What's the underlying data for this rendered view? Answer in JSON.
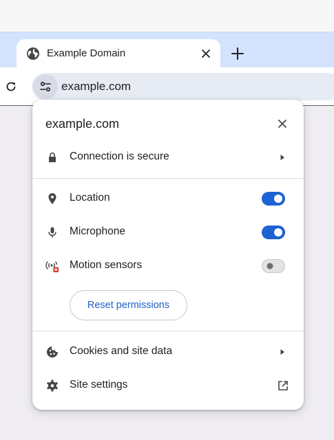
{
  "tab": {
    "title": "Example Domain",
    "icon": "globe-icon"
  },
  "omnibox": {
    "url": "example.com",
    "site_info_icon": "tune-icon"
  },
  "popup": {
    "title": "example.com",
    "connection_label": "Connection is secure",
    "permissions": [
      {
        "label": "Location",
        "icon": "location-pin-icon",
        "enabled": true
      },
      {
        "label": "Microphone",
        "icon": "microphone-icon",
        "enabled": true
      },
      {
        "label": "Motion sensors",
        "icon": "motion-sensors-blocked-icon",
        "enabled": false
      }
    ],
    "reset_label": "Reset permissions",
    "cookies_label": "Cookies and site data",
    "site_settings_label": "Site settings"
  },
  "colors": {
    "toggle_on": "#1f62d4",
    "link_blue": "#1f5fc7",
    "tabstrip_bg": "#d3e3fd",
    "omnibox_bg": "#e7ebf3",
    "blocked_red": "#d93025"
  }
}
